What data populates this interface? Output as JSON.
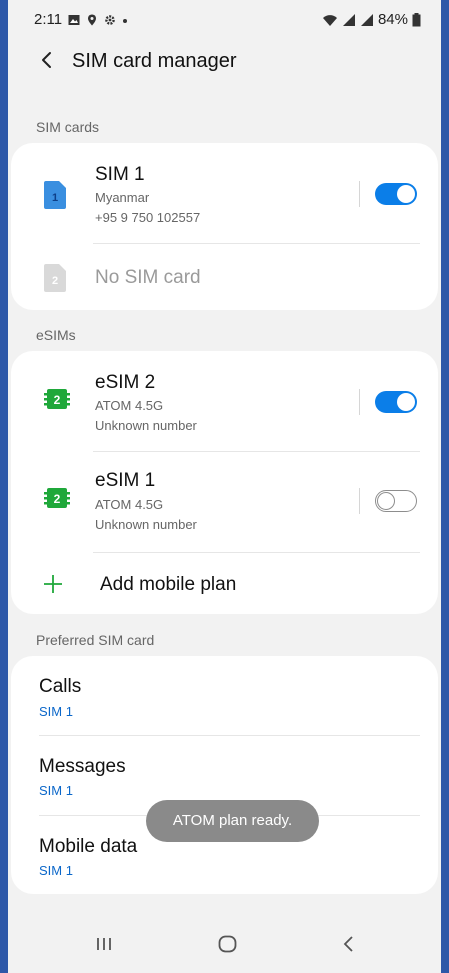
{
  "status_bar": {
    "time": "2:11",
    "battery": "84%",
    "icons_left": [
      "gallery-icon",
      "location-icon",
      "settings-icon",
      "dot-icon"
    ],
    "icons_right": [
      "wifi-icon",
      "signal-icon",
      "signal-icon",
      "battery-icon"
    ]
  },
  "header": {
    "title": "SIM card manager"
  },
  "sim_cards": {
    "label": "SIM cards",
    "sim1": {
      "name": "SIM 1",
      "carrier": "Myanmar",
      "number": "+95 9 750 102557",
      "enabled": true,
      "badge": "1"
    },
    "empty": {
      "name": "No SIM card",
      "badge": "2"
    }
  },
  "esims": {
    "label": "eSIMs",
    "items": [
      {
        "name": "eSIM 2",
        "carrier": "ATOM 4.5G",
        "number": "Unknown number",
        "enabled": true,
        "badge": "2"
      },
      {
        "name": "eSIM 1",
        "carrier": "ATOM 4.5G",
        "number": "Unknown number",
        "enabled": false,
        "badge": "2"
      }
    ],
    "add_label": "Add mobile plan"
  },
  "preferred": {
    "label": "Preferred SIM card",
    "items": [
      {
        "title": "Calls",
        "value": "SIM 1"
      },
      {
        "title": "Messages",
        "value": "SIM 1"
      },
      {
        "title": "Mobile data",
        "value": "SIM 1"
      }
    ]
  },
  "toast": {
    "text": "ATOM plan ready."
  },
  "colors": {
    "accent": "#0b7ee8",
    "esim_green": "#1fa83a",
    "sim_blue": "#3a8fe0",
    "frame": "#2e58a8"
  }
}
